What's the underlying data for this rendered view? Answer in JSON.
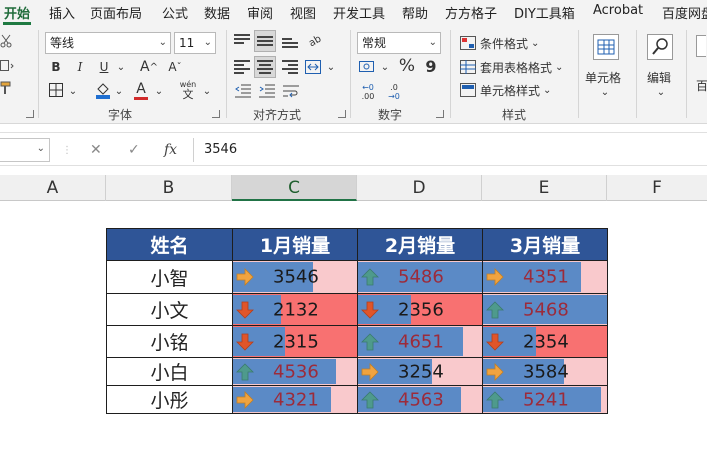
{
  "ribbon_tabs": [
    "开始",
    "插入",
    "页面布局",
    "公式",
    "数据",
    "审阅",
    "视图",
    "开发工具",
    "帮助",
    "方方格子",
    "DIY工具箱",
    "Acrobat",
    "百度网盘"
  ],
  "font": {
    "family_value": "等线",
    "size_value": "11",
    "bold": "B",
    "italic": "I",
    "underline": "U",
    "grow": "A",
    "shrink": "A",
    "font_color_glyph": "A",
    "highlight_glyph": "A",
    "wen": "wén",
    "wen_char": "文",
    "group_label": "字体"
  },
  "alignment": {
    "ab": "ab",
    "group_label": "对齐方式"
  },
  "number": {
    "format_value": "常规",
    "percent": "%",
    "comma": "9",
    "dec_inc": ".00",
    "dec_dec": ".0",
    "group_label": "数字"
  },
  "styles": {
    "conditional": "条件格式",
    "table_format": "套用表格格式",
    "cell_style": "单元格样式",
    "group_label": "样式"
  },
  "cells_label": "单元格",
  "edit_label": "编辑",
  "clipped_label": "百",
  "formula": {
    "cancel": "✕",
    "enter": "✓",
    "fx": "fx",
    "value": "3546"
  },
  "columns": [
    "A",
    "B",
    "C",
    "D",
    "E",
    "F"
  ],
  "table": {
    "headers": [
      "姓名",
      "1月销量",
      "2月销量",
      "3月销量"
    ],
    "rows": [
      {
        "name": "小智",
        "cells": [
          {
            "value": "3546",
            "icon": "right-arrow"
          },
          {
            "value": "5486",
            "icon": "up-arrow"
          },
          {
            "value": "4351",
            "icon": "right-arrow"
          }
        ]
      },
      {
        "name": "小文",
        "cells": [
          {
            "value": "2132",
            "icon": "down-arrow"
          },
          {
            "value": "2356",
            "icon": "down-arrow"
          },
          {
            "value": "5468",
            "icon": "up-arrow"
          }
        ]
      },
      {
        "name": "小铭",
        "cells": [
          {
            "value": "2315",
            "icon": "down-arrow"
          },
          {
            "value": "4651",
            "icon": "up-arrow"
          },
          {
            "value": "2354",
            "icon": "down-arrow"
          }
        ]
      },
      {
        "name": "小白",
        "cells": [
          {
            "value": "4536",
            "icon": "up-arrow"
          },
          {
            "value": "3254",
            "icon": "right-arrow"
          },
          {
            "value": "3584",
            "icon": "right-arrow"
          }
        ]
      },
      {
        "name": "小彤",
        "cells": [
          {
            "value": "4321",
            "icon": "right-arrow"
          },
          {
            "value": "4563",
            "icon": "up-arrow"
          },
          {
            "value": "5241",
            "icon": "up-arrow"
          }
        ]
      }
    ],
    "bar_max": 5486
  },
  "colors": {
    "header_bg": "#2f5597",
    "bar_blue": "#5b8ac6",
    "low_bg": "#f87171",
    "other_bg": "#f9c9cc",
    "text_dark": "#1a1a1a",
    "text_red": "#9c2b3a",
    "arrow_up": "#4e9a8c",
    "arrow_right": "#f0a340",
    "arrow_down": "#e0552a"
  }
}
